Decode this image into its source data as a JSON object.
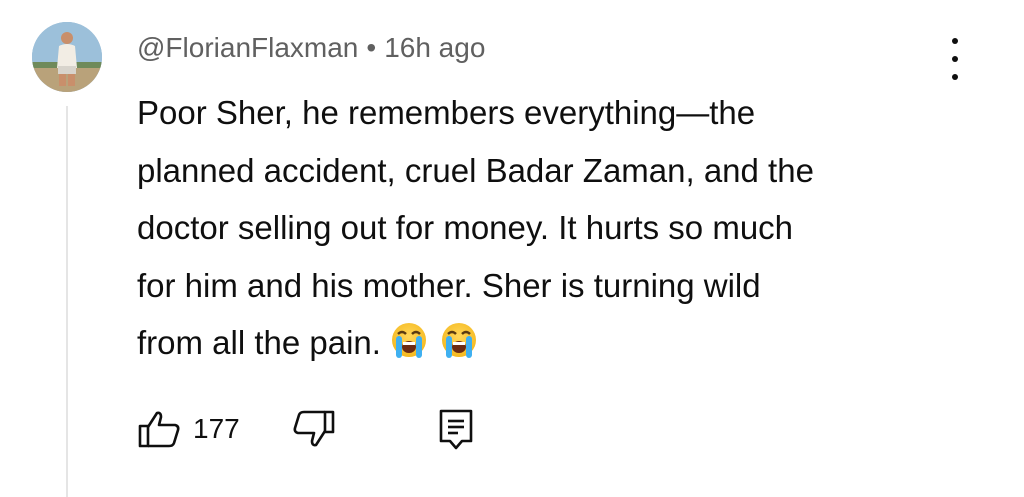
{
  "comment": {
    "author": "@FlorianFlaxman",
    "separator": "•",
    "timestamp": "16h ago",
    "text_lines": [
      "Poor Sher, he remembers everything—the",
      "planned accident, cruel Badar Zaman, and the",
      "doctor selling out for money. It hurts so much",
      "for him and his mother. Sher is turning wild",
      "from all the pain."
    ],
    "emojis": [
      "loudly-crying-face",
      "loudly-crying-face"
    ],
    "like_count": "177",
    "icons": {
      "more": "more-vert-icon",
      "like": "thumbs-up-icon",
      "dislike": "thumbs-down-icon",
      "reply": "reply-comment-icon"
    }
  }
}
